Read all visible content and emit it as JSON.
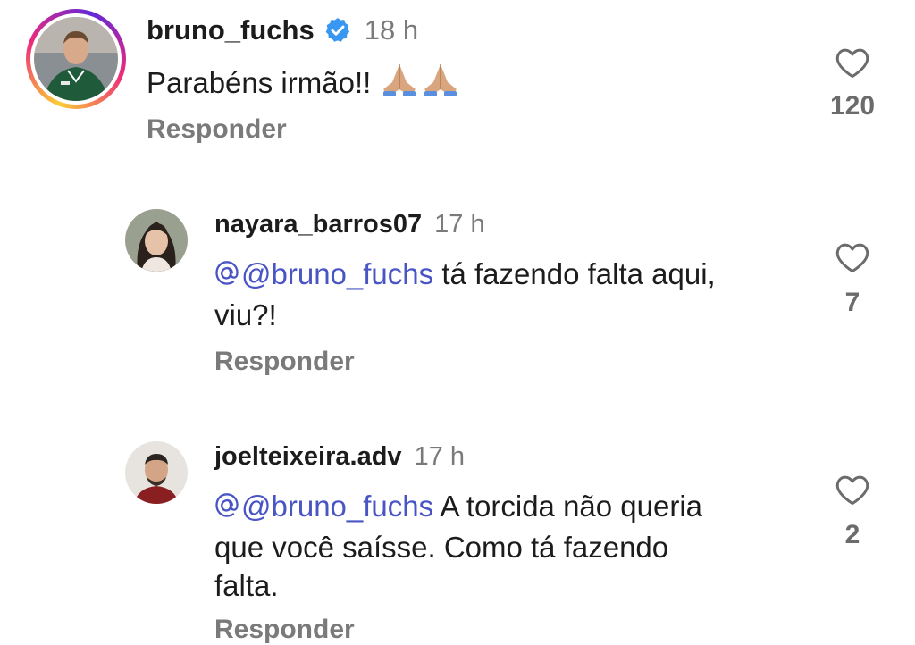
{
  "comments": [
    {
      "username": "bruno_fuchs",
      "verified": true,
      "time": "18 h",
      "text": "Parabéns irmão!!",
      "emoji": "pray-hands-icon",
      "reply_label": "Responder",
      "likes": "120"
    },
    {
      "username": "nayara_barros07",
      "time": "17 h",
      "mention": "@bruno_fuchs",
      "text": "tá fazendo falta aqui,",
      "text_line2": "viu?!",
      "reply_label": "Responder",
      "likes": "7"
    },
    {
      "username": "joelteixeira.adv",
      "time": "17 h",
      "mention": "@bruno_fuchs",
      "text": "A torcida não queria",
      "text_line2": "que você saísse. Como tá fazendo",
      "text_line3": "falta.",
      "reply_label": "Responder",
      "likes": "2"
    }
  ],
  "colors": {
    "mention": "#4a55c4",
    "verified": "#3897f0",
    "muted": "#7a7a7a"
  }
}
